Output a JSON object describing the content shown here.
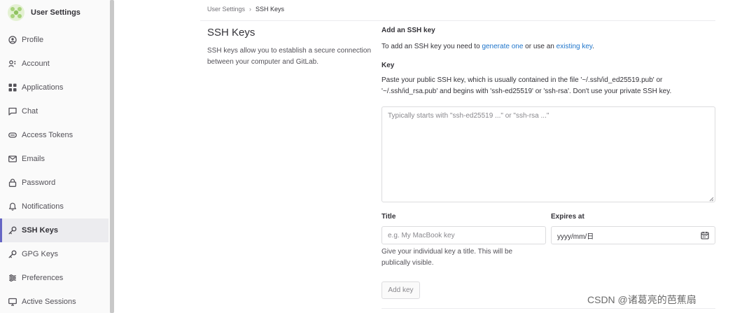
{
  "sidebar": {
    "title": "User Settings",
    "logo": "gitlab-avatar-icon",
    "items": [
      {
        "label": "Profile",
        "icon": "profile-icon"
      },
      {
        "label": "Account",
        "icon": "account-icon"
      },
      {
        "label": "Applications",
        "icon": "applications-icon"
      },
      {
        "label": "Chat",
        "icon": "chat-icon"
      },
      {
        "label": "Access Tokens",
        "icon": "token-icon"
      },
      {
        "label": "Emails",
        "icon": "mail-icon"
      },
      {
        "label": "Password",
        "icon": "lock-icon"
      },
      {
        "label": "Notifications",
        "icon": "bell-icon"
      },
      {
        "label": "SSH Keys",
        "icon": "key-icon",
        "active": true
      },
      {
        "label": "GPG Keys",
        "icon": "key-icon"
      },
      {
        "label": "Preferences",
        "icon": "preferences-icon"
      },
      {
        "label": "Active Sessions",
        "icon": "monitor-icon"
      }
    ]
  },
  "breadcrumb": {
    "parent": "User Settings",
    "separator": "›",
    "current": "SSH Keys"
  },
  "section": {
    "title": "SSH Keys",
    "description": "SSH keys allow you to establish a secure connection between your computer and GitLab."
  },
  "form": {
    "heading": "Add an SSH key",
    "intro_prefix": "To add an SSH key you need to ",
    "intro_link1": "generate one",
    "intro_middle": " or use an ",
    "intro_link2": "existing key",
    "intro_suffix": ".",
    "key_label": "Key",
    "key_help": "Paste your public SSH key, which is usually contained in the file '~/.ssh/id_ed25519.pub' or '~/.ssh/id_rsa.pub' and begins with 'ssh-ed25519' or 'ssh-rsa'. Don't use your private SSH key.",
    "key_placeholder": "Typically starts with \"ssh-ed25519 ...\" or \"ssh-rsa ...\"",
    "title_label": "Title",
    "title_placeholder": "e.g. My MacBook key",
    "title_help": "Give your individual key a title. This will be publically visible.",
    "expires_label": "Expires at",
    "expires_value": "yyyy/mm/日",
    "add_button": "Add key"
  },
  "watermark": "CSDN @诸葛亮的芭蕉扇",
  "colors": {
    "accent": "#6666c4",
    "link": "#1f75cb",
    "sidebar_bg": "#fafafa",
    "active_bg": "#ececef"
  }
}
